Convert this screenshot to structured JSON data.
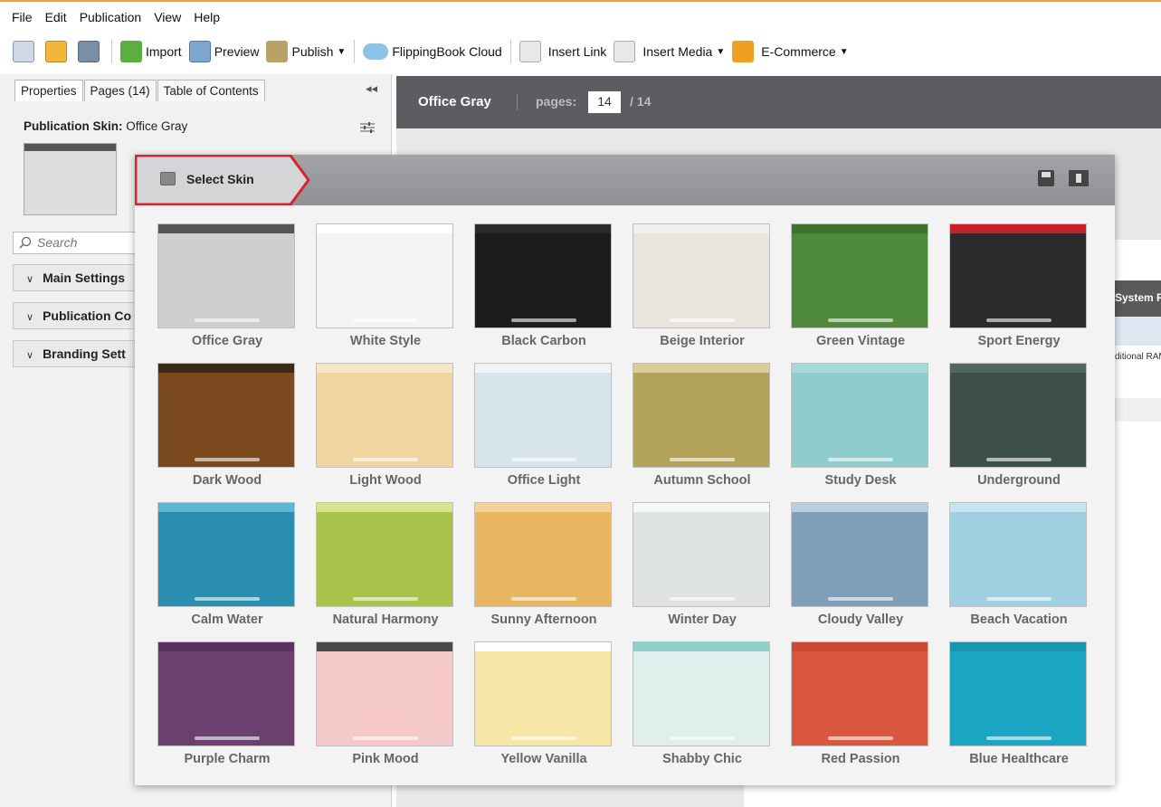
{
  "menu": [
    "File",
    "Edit",
    "Publication",
    "View",
    "Help"
  ],
  "toolbar": {
    "import": "Import",
    "preview": "Preview",
    "publish": "Publish",
    "cloud": "FlippingBook Cloud",
    "insert_link": "Insert Link",
    "insert_media": "Insert Media",
    "ecommerce": "E-Commerce"
  },
  "left": {
    "tabs": [
      "Properties",
      "Pages (14)",
      "Table of Contents"
    ],
    "skin_label": "Publication Skin:",
    "skin_value": "Office Gray",
    "search_placeholder": "Search",
    "sections": [
      "Main Settings",
      "Publication Co",
      "Branding Sett"
    ]
  },
  "header": {
    "title": "Office Gray",
    "pages_label": "pages:",
    "current_page": "14",
    "total": "/ 14"
  },
  "background": {
    "sys_req": "System Re",
    "ram": "ditional RAM)"
  },
  "dialog": {
    "title": "Select Skin",
    "skins": [
      {
        "name": "Office Gray",
        "bg": "#cfcfd0",
        "bar": "#555555"
      },
      {
        "name": "White Style",
        "bg": "#f4f4f4",
        "bar": "#ffffff"
      },
      {
        "name": "Black Carbon",
        "bg": "#1c1c1c",
        "bar": "#2a2a2a"
      },
      {
        "name": "Beige Interior",
        "bg": "#e9e5de",
        "bar": "#f2f0ec"
      },
      {
        "name": "Green Vintage",
        "bg": "#4e8a3a",
        "bar": "#3e7030"
      },
      {
        "name": "Sport Energy",
        "bg": "#2b2b2b",
        "bar": "#c8202a"
      },
      {
        "name": "Dark Wood",
        "bg": "#7a4a1e",
        "bar": "#3a2a18"
      },
      {
        "name": "Light Wood",
        "bg": "#f0d5a0",
        "bar": "#f6e6c6"
      },
      {
        "name": "Office Light",
        "bg": "#d7e4ea",
        "bar": "#eef3f5"
      },
      {
        "name": "Autumn School",
        "bg": "#b3a25a",
        "bar": "#d9cf9a"
      },
      {
        "name": "Study Desk",
        "bg": "#8fcccc",
        "bar": "#a8d8d8"
      },
      {
        "name": "Underground",
        "bg": "#3c4f4a",
        "bar": "#526660"
      },
      {
        "name": "Calm Water",
        "bg": "#2a8eb0",
        "bar": "#5eb6d2"
      },
      {
        "name": "Natural Harmony",
        "bg": "#a9c24a",
        "bar": "#d7e38f"
      },
      {
        "name": "Sunny Afternoon",
        "bg": "#e8b560",
        "bar": "#f2d29a"
      },
      {
        "name": "Winter Day",
        "bg": "#dfe3df",
        "bar": "#f7f7f7"
      },
      {
        "name": "Cloudy Valley",
        "bg": "#7f9fb8",
        "bar": "#b9cddc"
      },
      {
        "name": "Beach Vacation",
        "bg": "#9fd0e2",
        "bar": "#c8e4ee"
      },
      {
        "name": "Purple Charm",
        "bg": "#6b3f6e",
        "bar": "#5a3160"
      },
      {
        "name": "Pink Mood",
        "bg": "#f5c9c9",
        "bar": "#4a4a4a"
      },
      {
        "name": "Yellow Vanilla",
        "bg": "#f6e7a6",
        "bar": "#ffffff"
      },
      {
        "name": "Shabby Chic",
        "bg": "#dff0ec",
        "bar": "#8fd0cc"
      },
      {
        "name": "Red Passion",
        "bg": "#d9573e",
        "bar": "#c84a34"
      },
      {
        "name": "Blue Healthcare",
        "bg": "#1aa6c2",
        "bar": "#1796ae"
      }
    ]
  }
}
